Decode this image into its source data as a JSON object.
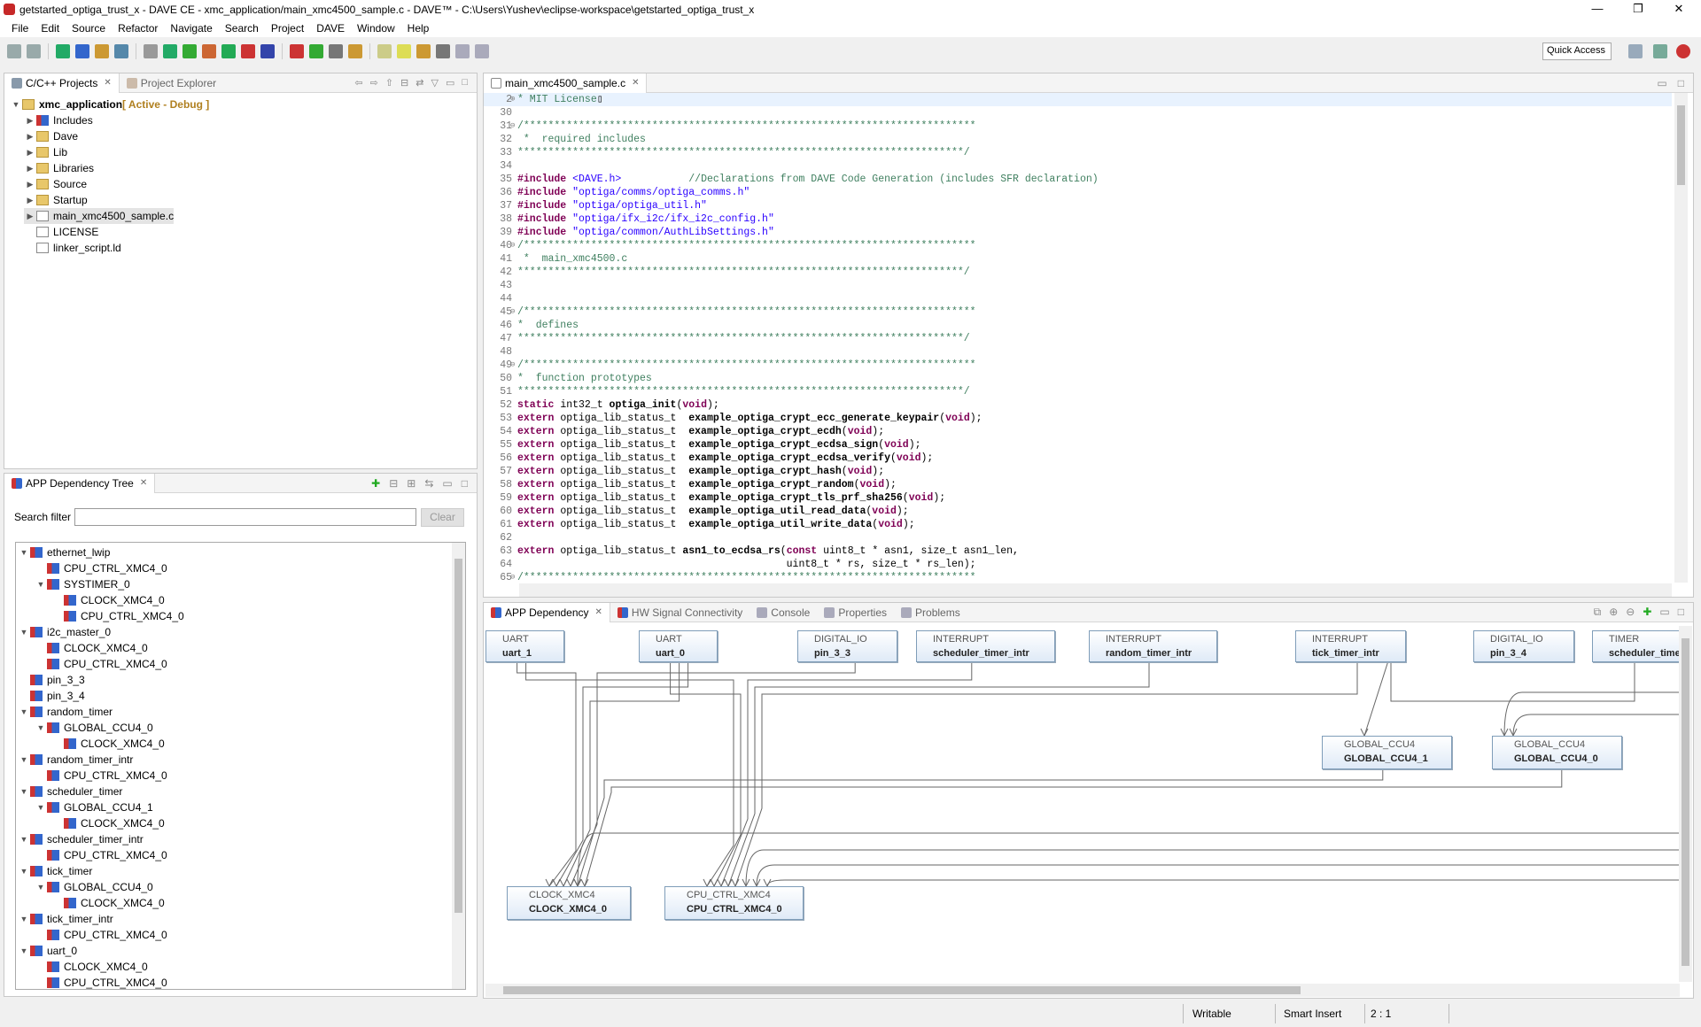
{
  "window": {
    "title": "getstarted_optiga_trust_x - DAVE CE - xmc_application/main_xmc4500_sample.c - DAVE™ - C:\\Users\\Yushev\\eclipse-workspace\\getstarted_optiga_trust_x",
    "minimize": "—",
    "maximize": "❐",
    "close": "✕"
  },
  "menu": [
    "File",
    "Edit",
    "Source",
    "Refactor",
    "Navigate",
    "Search",
    "Project",
    "DAVE",
    "Window",
    "Help"
  ],
  "toolbar": {
    "quick_access": "Quick Access",
    "colors": [
      "#9aa",
      "#9aa",
      "#2a6",
      "#36c",
      "#c93",
      "#58a",
      "#999",
      "#2a6",
      "#3a3",
      "#c63",
      "#2a5",
      "#c33",
      "#34a",
      "#c33",
      "#3a3",
      "#777",
      "#c93",
      "#cc8",
      "#dd5",
      "#c93",
      "#777",
      "#aab",
      "#aab"
    ]
  },
  "project_explorer": {
    "tabs": [
      "C/C++ Projects",
      "Project Explorer"
    ],
    "items": [
      {
        "label": "xmc_application",
        "suffix": " [ Active - Debug ]",
        "depth": 0,
        "arrow": "v",
        "icon": "project"
      },
      {
        "label": "Includes",
        "depth": 1,
        "arrow": ">",
        "icon": "includes"
      },
      {
        "label": "Dave",
        "depth": 1,
        "arrow": ">",
        "icon": "folder"
      },
      {
        "label": "Lib",
        "depth": 1,
        "arrow": ">",
        "icon": "folder"
      },
      {
        "label": "Libraries",
        "depth": 1,
        "arrow": ">",
        "icon": "folder"
      },
      {
        "label": "Source",
        "depth": 1,
        "arrow": ">",
        "icon": "folder"
      },
      {
        "label": "Startup",
        "depth": 1,
        "arrow": ">",
        "icon": "folder"
      },
      {
        "label": "main_xmc4500_sample.c",
        "depth": 1,
        "arrow": ">",
        "icon": "cfile",
        "selected": true
      },
      {
        "label": "LICENSE",
        "depth": 1,
        "arrow": "",
        "icon": "file"
      },
      {
        "label": "linker_script.ld",
        "depth": 1,
        "arrow": "",
        "icon": "file"
      }
    ]
  },
  "app_tree": {
    "tab": "APP Dependency Tree",
    "search_label": "Search filter",
    "search_value": "",
    "clear": "Clear",
    "items": [
      {
        "label": "ethernet_lwip",
        "depth": 0,
        "arrow": "v"
      },
      {
        "label": "CPU_CTRL_XMC4_0",
        "depth": 1,
        "arrow": ""
      },
      {
        "label": "SYSTIMER_0",
        "depth": 1,
        "arrow": "v"
      },
      {
        "label": "CLOCK_XMC4_0",
        "depth": 2,
        "arrow": ""
      },
      {
        "label": "CPU_CTRL_XMC4_0",
        "depth": 2,
        "arrow": ""
      },
      {
        "label": "i2c_master_0",
        "depth": 0,
        "arrow": "v"
      },
      {
        "label": "CLOCK_XMC4_0",
        "depth": 1,
        "arrow": ""
      },
      {
        "label": "CPU_CTRL_XMC4_0",
        "depth": 1,
        "arrow": ""
      },
      {
        "label": "pin_3_3",
        "depth": 0,
        "arrow": ""
      },
      {
        "label": "pin_3_4",
        "depth": 0,
        "arrow": ""
      },
      {
        "label": "random_timer",
        "depth": 0,
        "arrow": "v"
      },
      {
        "label": "GLOBAL_CCU4_0",
        "depth": 1,
        "arrow": "v"
      },
      {
        "label": "CLOCK_XMC4_0",
        "depth": 2,
        "arrow": ""
      },
      {
        "label": "random_timer_intr",
        "depth": 0,
        "arrow": "v"
      },
      {
        "label": "CPU_CTRL_XMC4_0",
        "depth": 1,
        "arrow": ""
      },
      {
        "label": "scheduler_timer",
        "depth": 0,
        "arrow": "v"
      },
      {
        "label": "GLOBAL_CCU4_1",
        "depth": 1,
        "arrow": "v"
      },
      {
        "label": "CLOCK_XMC4_0",
        "depth": 2,
        "arrow": ""
      },
      {
        "label": "scheduler_timer_intr",
        "depth": 0,
        "arrow": "v"
      },
      {
        "label": "CPU_CTRL_XMC4_0",
        "depth": 1,
        "arrow": ""
      },
      {
        "label": "tick_timer",
        "depth": 0,
        "arrow": "v"
      },
      {
        "label": "GLOBAL_CCU4_0",
        "depth": 1,
        "arrow": "v"
      },
      {
        "label": "CLOCK_XMC4_0",
        "depth": 2,
        "arrow": ""
      },
      {
        "label": "tick_timer_intr",
        "depth": 0,
        "arrow": "v"
      },
      {
        "label": "CPU_CTRL_XMC4_0",
        "depth": 1,
        "arrow": ""
      },
      {
        "label": "uart_0",
        "depth": 0,
        "arrow": "v"
      },
      {
        "label": "CLOCK_XMC4_0",
        "depth": 1,
        "arrow": ""
      },
      {
        "label": "CPU_CTRL_XMC4_0",
        "depth": 1,
        "arrow": ""
      }
    ]
  },
  "editor": {
    "tab": "main_xmc4500_sample.c",
    "lines": [
      {
        "n": "2",
        "fold": "+",
        "hl": true,
        "s": [
          [
            "cm",
            "* MIT License"
          ],
          [
            "",
            "▯"
          ]
        ]
      },
      {
        "n": "30",
        "s": []
      },
      {
        "n": "31",
        "fold": "-",
        "s": [
          [
            "cm",
            "/**************************************************************************"
          ]
        ]
      },
      {
        "n": "32",
        "s": [
          [
            "cm",
            " *  required includes"
          ]
        ]
      },
      {
        "n": "33",
        "s": [
          [
            "cm",
            "*************************************************************************/"
          ]
        ]
      },
      {
        "n": "34",
        "s": []
      },
      {
        "n": "35",
        "s": [
          [
            "kw",
            "#include"
          ],
          [
            "",
            " "
          ],
          [
            "st",
            "<DAVE.h>"
          ],
          [
            "",
            "           "
          ],
          [
            "cm",
            "//Declarations from DAVE Code Generation (includes SFR declaration)"
          ]
        ]
      },
      {
        "n": "36",
        "s": [
          [
            "kw",
            "#include"
          ],
          [
            "",
            " "
          ],
          [
            "st",
            "\"optiga/comms/optiga_comms.h\""
          ]
        ]
      },
      {
        "n": "37",
        "s": [
          [
            "kw",
            "#include"
          ],
          [
            "",
            " "
          ],
          [
            "st",
            "\"optiga/optiga_util.h\""
          ]
        ]
      },
      {
        "n": "38",
        "s": [
          [
            "kw",
            "#include"
          ],
          [
            "",
            " "
          ],
          [
            "st",
            "\"optiga/ifx_i2c/ifx_i2c_config.h\""
          ]
        ]
      },
      {
        "n": "39",
        "s": [
          [
            "kw",
            "#include"
          ],
          [
            "",
            " "
          ],
          [
            "st",
            "\"optiga/common/AuthLibSettings.h\""
          ]
        ]
      },
      {
        "n": "40",
        "fold": "-",
        "s": [
          [
            "cm",
            "/**************************************************************************"
          ]
        ]
      },
      {
        "n": "41",
        "s": [
          [
            "cm",
            " *  main_xmc4500.c"
          ]
        ]
      },
      {
        "n": "42",
        "s": [
          [
            "cm",
            "*************************************************************************/"
          ]
        ]
      },
      {
        "n": "43",
        "s": []
      },
      {
        "n": "44",
        "s": []
      },
      {
        "n": "45",
        "fold": "-",
        "s": [
          [
            "cm",
            "/**************************************************************************"
          ]
        ]
      },
      {
        "n": "46",
        "s": [
          [
            "cm",
            "*  defines"
          ]
        ]
      },
      {
        "n": "47",
        "s": [
          [
            "cm",
            "*************************************************************************/"
          ]
        ]
      },
      {
        "n": "48",
        "s": []
      },
      {
        "n": "49",
        "fold": "-",
        "s": [
          [
            "cm",
            "/**************************************************************************"
          ]
        ]
      },
      {
        "n": "50",
        "s": [
          [
            "cm",
            "*  function prototypes"
          ]
        ]
      },
      {
        "n": "51",
        "s": [
          [
            "cm",
            "*************************************************************************/"
          ]
        ]
      },
      {
        "n": "52",
        "s": [
          [
            "kw",
            "static"
          ],
          [
            "",
            " int32_t "
          ],
          [
            "fn",
            "optiga_init"
          ],
          [
            "",
            "("
          ],
          [
            "kw",
            "void"
          ],
          [
            "",
            ");"
          ]
        ]
      },
      {
        "n": "53",
        "s": [
          [
            "kw",
            "extern"
          ],
          [
            "",
            " optiga_lib_status_t  "
          ],
          [
            "fn",
            "example_optiga_crypt_ecc_generate_keypair"
          ],
          [
            "",
            "("
          ],
          [
            "kw",
            "void"
          ],
          [
            "",
            ");"
          ]
        ]
      },
      {
        "n": "54",
        "s": [
          [
            "kw",
            "extern"
          ],
          [
            "",
            " optiga_lib_status_t  "
          ],
          [
            "fn",
            "example_optiga_crypt_ecdh"
          ],
          [
            "",
            "("
          ],
          [
            "kw",
            "void"
          ],
          [
            "",
            ");"
          ]
        ]
      },
      {
        "n": "55",
        "s": [
          [
            "kw",
            "extern"
          ],
          [
            "",
            " optiga_lib_status_t  "
          ],
          [
            "fn",
            "example_optiga_crypt_ecdsa_sign"
          ],
          [
            "",
            "("
          ],
          [
            "kw",
            "void"
          ],
          [
            "",
            ");"
          ]
        ]
      },
      {
        "n": "56",
        "s": [
          [
            "kw",
            "extern"
          ],
          [
            "",
            " optiga_lib_status_t  "
          ],
          [
            "fn",
            "example_optiga_crypt_ecdsa_verify"
          ],
          [
            "",
            "("
          ],
          [
            "kw",
            "void"
          ],
          [
            "",
            ");"
          ]
        ]
      },
      {
        "n": "57",
        "s": [
          [
            "kw",
            "extern"
          ],
          [
            "",
            " optiga_lib_status_t  "
          ],
          [
            "fn",
            "example_optiga_crypt_hash"
          ],
          [
            "",
            "("
          ],
          [
            "kw",
            "void"
          ],
          [
            "",
            ");"
          ]
        ]
      },
      {
        "n": "58",
        "s": [
          [
            "kw",
            "extern"
          ],
          [
            "",
            " optiga_lib_status_t  "
          ],
          [
            "fn",
            "example_optiga_crypt_random"
          ],
          [
            "",
            "("
          ],
          [
            "kw",
            "void"
          ],
          [
            "",
            ");"
          ]
        ]
      },
      {
        "n": "59",
        "s": [
          [
            "kw",
            "extern"
          ],
          [
            "",
            " optiga_lib_status_t  "
          ],
          [
            "fn",
            "example_optiga_crypt_tls_prf_sha256"
          ],
          [
            "",
            "("
          ],
          [
            "kw",
            "void"
          ],
          [
            "",
            ");"
          ]
        ]
      },
      {
        "n": "60",
        "s": [
          [
            "kw",
            "extern"
          ],
          [
            "",
            " optiga_lib_status_t  "
          ],
          [
            "fn",
            "example_optiga_util_read_data"
          ],
          [
            "",
            "("
          ],
          [
            "kw",
            "void"
          ],
          [
            "",
            ");"
          ]
        ]
      },
      {
        "n": "61",
        "s": [
          [
            "kw",
            "extern"
          ],
          [
            "",
            " optiga_lib_status_t  "
          ],
          [
            "fn",
            "example_optiga_util_write_data"
          ],
          [
            "",
            "("
          ],
          [
            "kw",
            "void"
          ],
          [
            "",
            ");"
          ]
        ]
      },
      {
        "n": "62",
        "s": []
      },
      {
        "n": "63",
        "s": [
          [
            "kw",
            "extern"
          ],
          [
            "",
            " optiga_lib_status_t "
          ],
          [
            "fn",
            "asn1_to_ecdsa_rs"
          ],
          [
            "",
            "("
          ],
          [
            "kw",
            "const"
          ],
          [
            "",
            " uint8_t * asn1, size_t asn1_len,"
          ]
        ]
      },
      {
        "n": "64",
        "s": [
          [
            "",
            "                                            uint8_t * rs, size_t * rs_len);"
          ]
        ]
      },
      {
        "n": "65",
        "fold": "-",
        "s": [
          [
            "cm",
            "/**************************************************************************"
          ]
        ]
      }
    ]
  },
  "bottom": {
    "tabs": [
      "APP Dependency",
      "HW Signal Connectivity",
      "Console",
      "Properties",
      "Problems"
    ],
    "nodes": [
      {
        "id": "uart_1",
        "type": "UART",
        "name": "uart_1"
      },
      {
        "id": "uart_0",
        "type": "UART",
        "name": "uart_0"
      },
      {
        "id": "pin_3_3",
        "type": "DIGITAL_IO",
        "name": "pin_3_3"
      },
      {
        "id": "sched_intr",
        "type": "INTERRUPT",
        "name": "scheduler_timer_intr"
      },
      {
        "id": "random_intr",
        "type": "INTERRUPT",
        "name": "random_timer_intr"
      },
      {
        "id": "tick_intr",
        "type": "INTERRUPT",
        "name": "tick_timer_intr"
      },
      {
        "id": "pin_3_4",
        "type": "DIGITAL_IO",
        "name": "pin_3_4"
      },
      {
        "id": "sched_timer",
        "type": "TIMER",
        "name": "scheduler_timer"
      },
      {
        "id": "ccu4_1",
        "type": "GLOBAL_CCU4",
        "name": "GLOBAL_CCU4_1"
      },
      {
        "id": "ccu4_0",
        "type": "GLOBAL_CCU4",
        "name": "GLOBAL_CCU4_0"
      },
      {
        "id": "clock",
        "type": "CLOCK_XMC4",
        "name": "CLOCK_XMC4_0"
      },
      {
        "id": "cpu",
        "type": "CPU_CTRL_XMC4",
        "name": "CPU_CTRL_XMC4_0"
      }
    ],
    "edges": [
      [
        "uart_1",
        "clock"
      ],
      [
        "uart_1",
        "cpu"
      ],
      [
        "uart_0",
        "clock"
      ],
      [
        "uart_0",
        "cpu"
      ],
      [
        "uart_0",
        "clock"
      ],
      [
        "pin_3_3",
        "clock"
      ],
      [
        "sched_intr",
        "cpu"
      ],
      [
        "random_intr",
        "cpu"
      ],
      [
        "tick_intr",
        "cpu"
      ],
      [
        "sched_timer",
        "ccu4_1"
      ],
      [
        "ccu4_1",
        "clock"
      ],
      [
        "ccu4_0",
        "clock"
      ]
    ]
  },
  "status": {
    "writable": "Writable",
    "insert": "Smart Insert",
    "position": "2 : 1"
  }
}
